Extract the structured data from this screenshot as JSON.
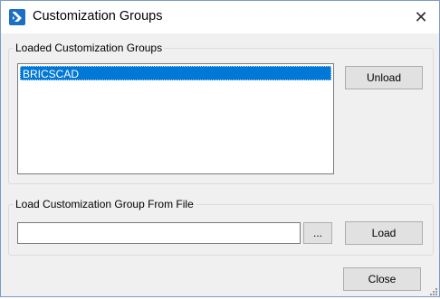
{
  "window": {
    "title": "Customization Groups",
    "close_glyph": "✕"
  },
  "loaded_group": {
    "legend": "Loaded Customization Groups",
    "items": [
      "BRICSCAD"
    ],
    "unload_label": "Unload"
  },
  "load_group": {
    "legend": "Load Customization Group From File",
    "file_value": "",
    "browse_label": "...",
    "load_label": "Load"
  },
  "footer": {
    "close_label": "Close"
  },
  "colors": {
    "selection": "#0078d7",
    "icon": "#1d6fc4"
  },
  "icons": [
    "bricscad-app-icon",
    "close-icon",
    "resize-grip-icon"
  ]
}
